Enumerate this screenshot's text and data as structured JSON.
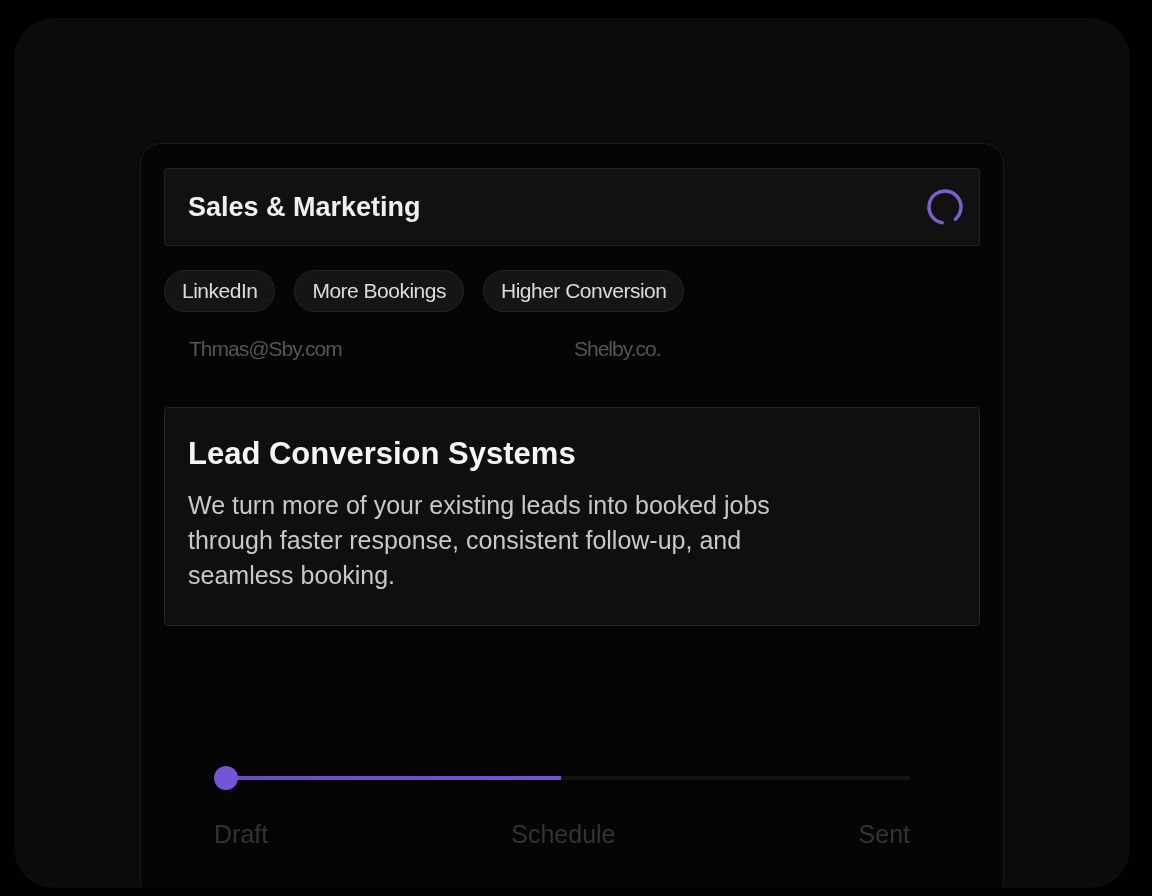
{
  "header": {
    "title": "Sales & Marketing",
    "loading": true
  },
  "tags": [
    {
      "label": "LinkedIn"
    },
    {
      "label": "More Bookings"
    },
    {
      "label": "Higher Conversion"
    }
  ],
  "faded_fields": [
    {
      "text": "Thmas@Sby.com"
    },
    {
      "text": "Shelby.co."
    }
  ],
  "feature": {
    "title": "Lead Conversion Systems",
    "body": "We turn more of your existing leads into booked jobs through faster response, consistent follow-up, and seamless booking."
  },
  "progress": {
    "level": 0.48,
    "steps": [
      {
        "label": "Draft"
      },
      {
        "label": "Schedule"
      },
      {
        "label": "Sent"
      }
    ]
  }
}
